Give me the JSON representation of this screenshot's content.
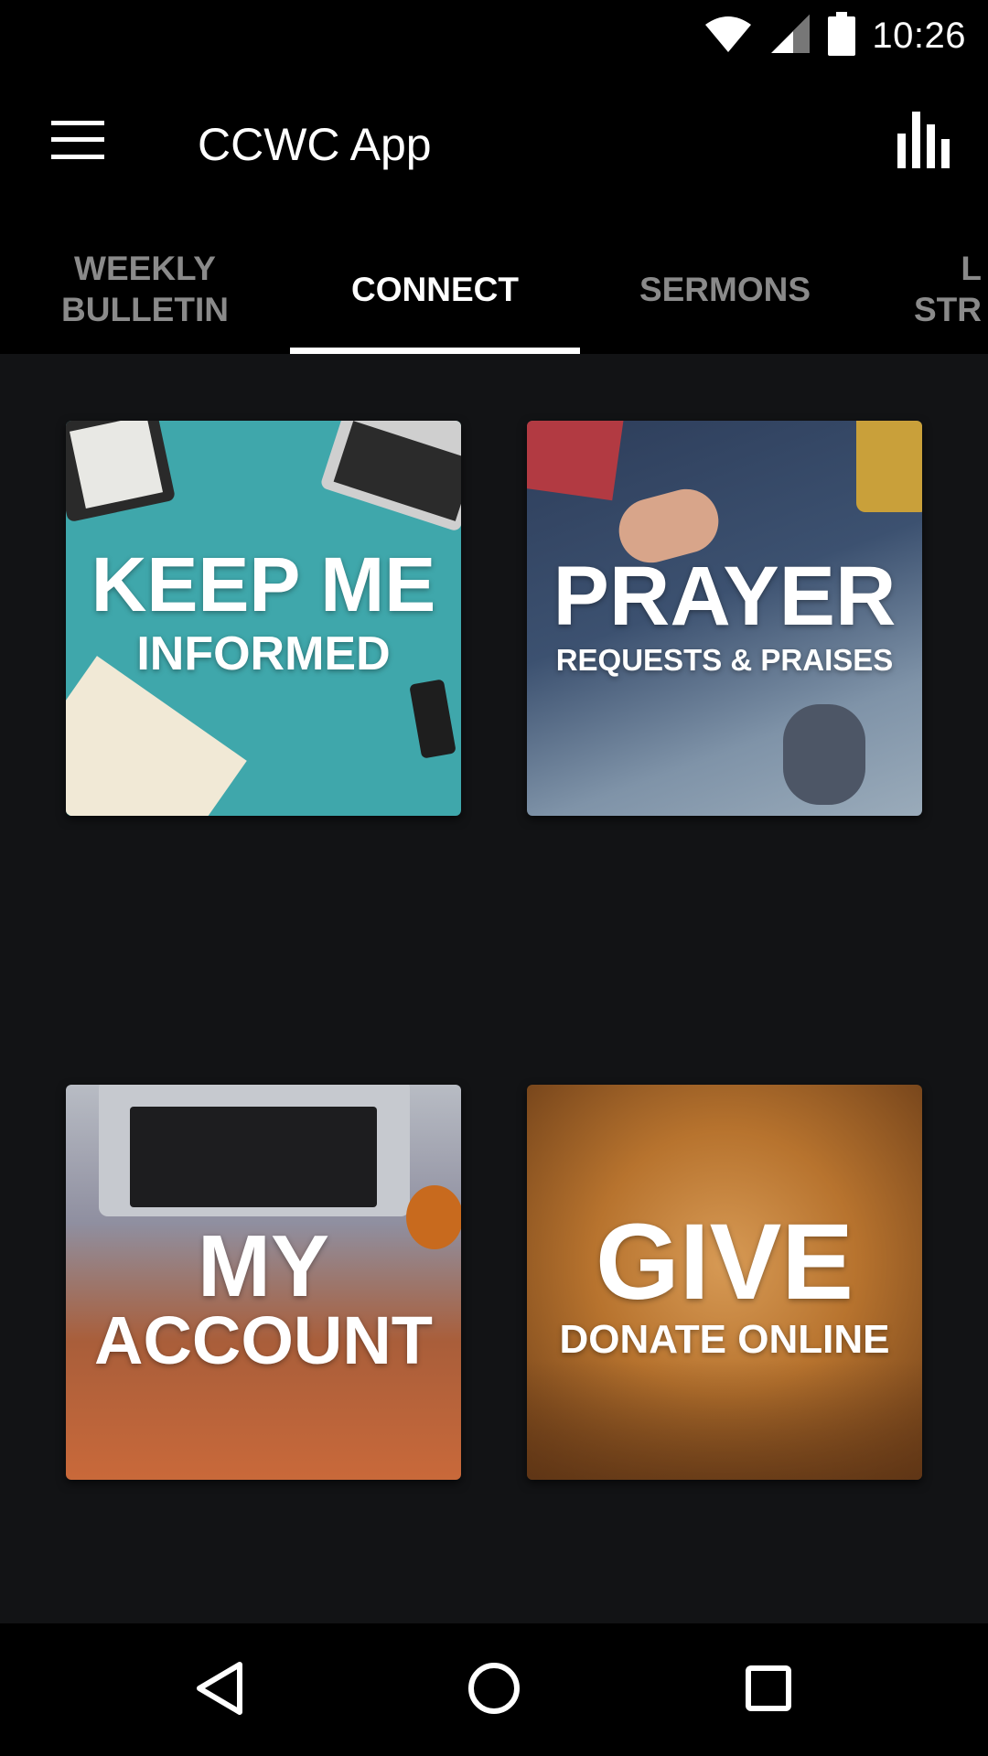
{
  "status_bar": {
    "time": "10:26",
    "icons": [
      "wifi-icon",
      "cell-signal-icon",
      "battery-icon"
    ]
  },
  "app_bar": {
    "title": "CCWC App",
    "menu_icon": "hamburger-menu-icon",
    "action_icon": "bar-chart-icon"
  },
  "tabs": [
    {
      "label": "WEEKLY BULLETIN",
      "line1": "WEEKLY",
      "line2": "BULLETIN",
      "active": false
    },
    {
      "label": "CONNECT",
      "line1": "CONNECT",
      "line2": "",
      "active": true
    },
    {
      "label": "SERMONS",
      "line1": "SERMONS",
      "line2": "",
      "active": false
    },
    {
      "label": "LIVE STREAM",
      "line1": "L",
      "line2": "STR",
      "active": false
    }
  ],
  "tiles": [
    {
      "big": "KEEP ME",
      "small": "INFORMED"
    },
    {
      "big": "PRAYER",
      "small": "REQUESTS & PRAISES"
    },
    {
      "big": "MY",
      "small": "ACCOUNT"
    },
    {
      "big": "GIVE",
      "small": "DONATE ONLINE"
    }
  ],
  "nav_bar": {
    "icons": [
      "back-icon",
      "home-icon",
      "recents-icon"
    ]
  },
  "colors": {
    "background": "#000000",
    "content_background": "#121315",
    "tab_active": "#ffffff",
    "tab_inactive": "#8a8a8a",
    "keep_tile": "#3fa7ab"
  }
}
